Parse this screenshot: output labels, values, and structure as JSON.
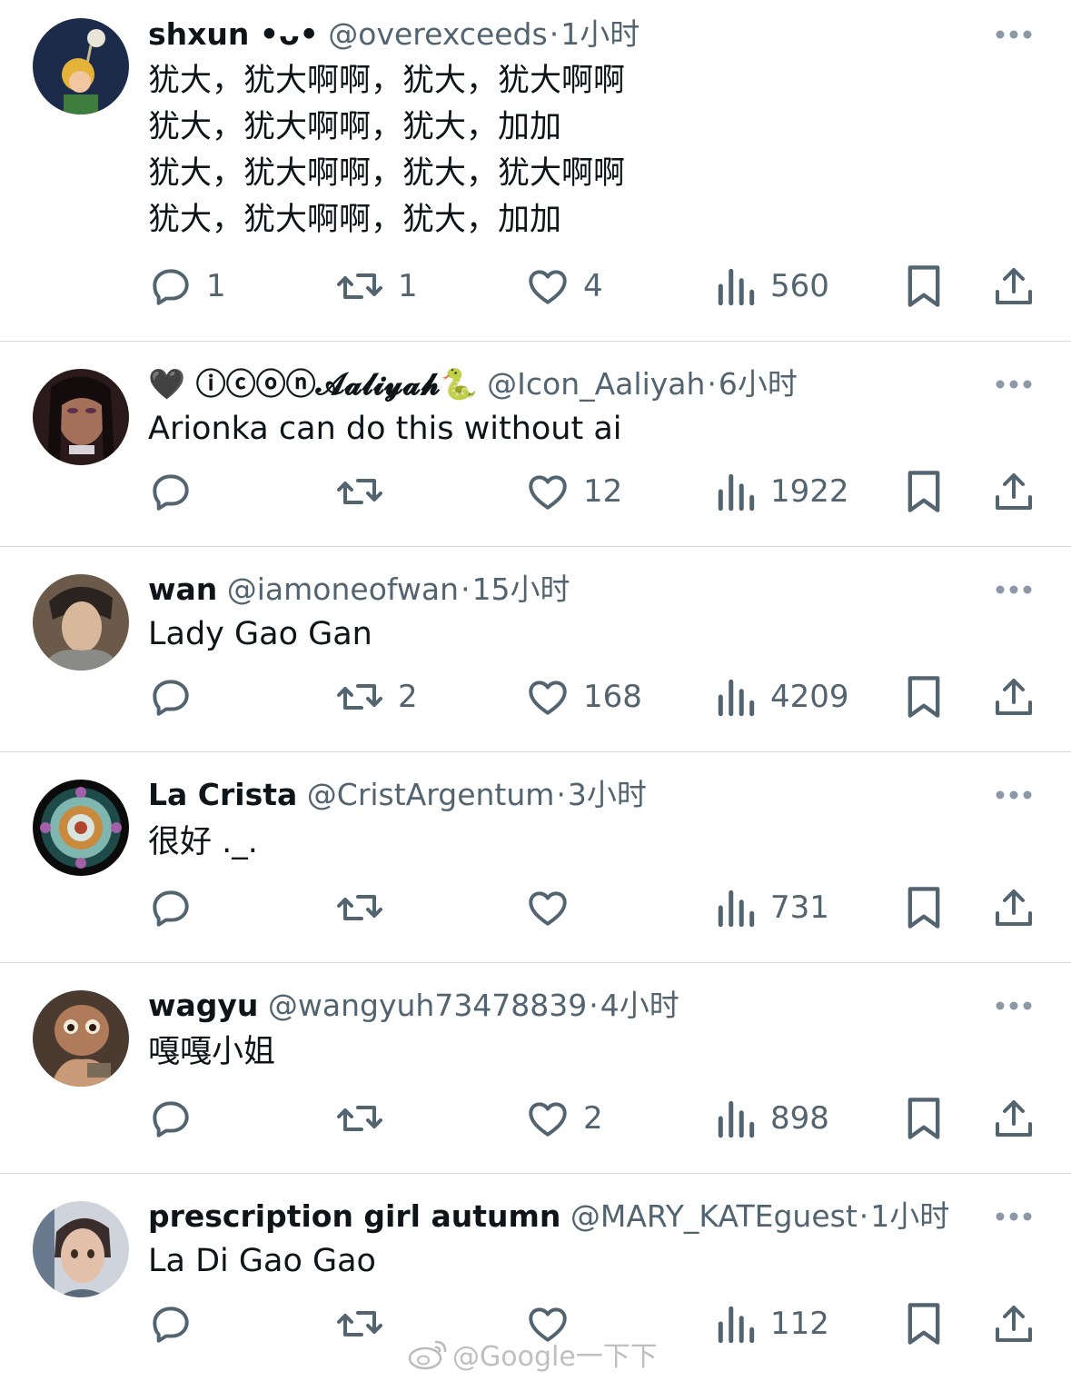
{
  "tweets": [
    {
      "name": "shxun •ᴗ•",
      "handle": "@overexceeds",
      "separator": "·",
      "time": "1小时",
      "text": "犹大，犹大啊啊，犹大，犹大啊啊\n犹大，犹大啊啊，犹大，加加\n犹大，犹大啊啊，犹大，犹大啊啊\n犹大，犹大啊啊，犹大，加加",
      "replies": "1",
      "retweets": "1",
      "likes": "4",
      "views": "560"
    },
    {
      "name": "🖤 ⓘⓒⓞⓝ𝓐𝓪𝓵𝓲𝔂𝓪𝓱🐍",
      "handle": "@Icon_Aaliyah",
      "separator": "·",
      "time": "6小时",
      "text": "Arionka can do this without ai",
      "replies": "",
      "retweets": "",
      "likes": "12",
      "views": "1922"
    },
    {
      "name": "wan",
      "handle": "@iamoneofwan",
      "separator": "·",
      "time": "15小时",
      "text": "Lady Gao Gan",
      "replies": "",
      "retweets": "2",
      "likes": "168",
      "views": "4209"
    },
    {
      "name": "La Crista",
      "handle": "@CristArgentum",
      "separator": "·",
      "time": "3小时",
      "text": "很好 ._.",
      "replies": "",
      "retweets": "",
      "likes": "",
      "views": "731"
    },
    {
      "name": "wagyu",
      "handle": "@wangyuh73478839",
      "separator": "·",
      "time": "4小时",
      "text": "嘎嘎小姐",
      "replies": "",
      "retweets": "",
      "likes": "2",
      "views": "898"
    },
    {
      "name": "prescription girl autumn",
      "handle": "@MARY_KATEguest",
      "separator": "·",
      "time": "1小时",
      "text": "La Di Gao Gao",
      "replies": "",
      "retweets": "",
      "likes": "",
      "views": "112"
    }
  ],
  "watermark": "@Google一下下",
  "icons": {
    "reply": "reply-icon",
    "retweet": "retweet-icon",
    "like": "heart-icon",
    "views": "views-chart-icon",
    "bookmark": "bookmark-icon",
    "share": "share-icon",
    "more": "more-dots-icon"
  },
  "colors": {
    "text": "#0f1419",
    "secondary": "#536471",
    "divider": "#d6dadd"
  }
}
